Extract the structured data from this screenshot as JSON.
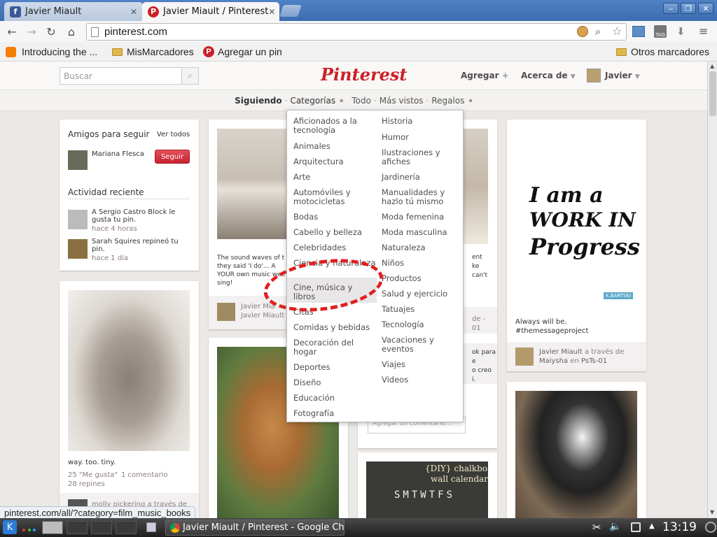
{
  "browser": {
    "tabs": [
      {
        "label": "Javier Miault",
        "close": "✕"
      },
      {
        "label": "Javier Miault / Pinterest",
        "close": "✕"
      }
    ],
    "window_buttons": [
      "‒",
      "❐",
      "✕"
    ],
    "url": "pinterest.com",
    "bookmarks": [
      "Introducing the ...",
      "MisMarcadores",
      "Agregar un pin",
      "Otros marcadores"
    ],
    "status_url": "pinterest.com/all/?category=film_music_books"
  },
  "header": {
    "search_placeholder": "Buscar",
    "logo": "Pinterest",
    "add": "Agregar",
    "about": "Acerca de",
    "user": "Javier"
  },
  "subnav": {
    "following": "Siguiendo",
    "categories": "Categorías",
    "all": "Todo",
    "popular": "Más vistos",
    "gifts": "Regalos"
  },
  "sidebar": {
    "friends_title": "Amigos para seguir",
    "see_all": "Ver todos",
    "friend_name": "Mariana Flesca",
    "follow_button": "Seguir",
    "activity_title": "Actividad reciente",
    "activities": [
      {
        "text": "A Sergio Castro Block le gusta tu pin.",
        "time": "hace 4 horas"
      },
      {
        "text": "Sarah Squires repineó tu pin.",
        "time": "hace 1 día"
      }
    ]
  },
  "pins": {
    "bunny_caption": "way. too. tiny.",
    "bunny_likes": "25 \"Me gusta\"",
    "bunny_comments": "1 comentario",
    "bunny_repins": "28 repines",
    "bunny_pinner": "molly pickering a través de",
    "sound_caption": "The sound waves of t they said 'I do'... A YOUR own music wee sing!",
    "sound_pinner_1": "Javier Mia",
    "sound_pinner_2": "Javier Miault",
    "middle_frag_1": "ent",
    "middle_frag_2": "ke",
    "middle_frag_3": "can't",
    "middle_frag_4": "de -",
    "middle_frag_5": "01",
    "middle_frag_6": "ok para",
    "middle_frag_7": "e",
    "middle_frag_8": "o creo",
    "middle_frag_9": "i.",
    "calendar_line1": "{DIY} chalkboard",
    "calendar_line2": "wall calendar",
    "calendar_days": "SMTWTFS",
    "quote_line1": "I am a",
    "quote_line2": "WORK IN",
    "quote_line3": "Progress",
    "quote_sig": "K.BARTSKI",
    "quote_caption": "Always will be. #themessageproject",
    "quote_pinner": "Javier Miault",
    "quote_via": "a través de",
    "quote_source": "Maiysha",
    "quote_in": "en",
    "quote_board": "PsTs-01",
    "comment_placeholder": "Agregar un comentario..."
  },
  "categories": {
    "left": [
      "Aficionados a la tecnología",
      "Animales",
      "Arquitectura",
      "Arte",
      "Automóviles y motocicletas",
      "Bodas",
      "Cabello y belleza",
      "Celebridades",
      "Ciencia y naturaleza",
      "Cine, música y libros",
      "Citas",
      "Comidas y bebidas",
      "Decoración del hogar",
      "Deportes",
      "Diseño",
      "Educación",
      "Fotografía"
    ],
    "right": [
      "Historia",
      "Humor",
      "Ilustraciones y afiches",
      "Jardinería",
      "Manualidades y hazlo tú mismo",
      "Moda femenina",
      "Moda masculina",
      "Naturaleza",
      "Niños",
      "Productos",
      "Salud y ejercicio",
      "Tatuajes",
      "Tecnología",
      "Vacaciones y eventos",
      "Viajes",
      "Videos"
    ]
  },
  "taskbar": {
    "task": "Javier Miault / Pinterest - Google Chro",
    "clock": "13:19"
  }
}
